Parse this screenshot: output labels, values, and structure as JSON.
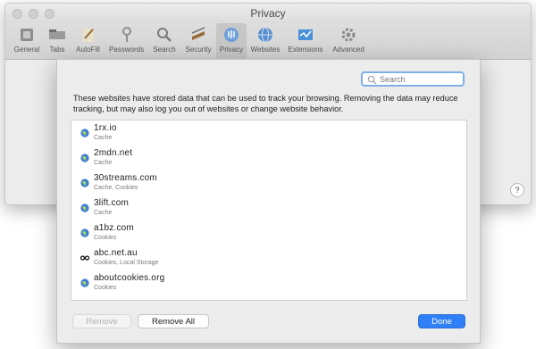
{
  "window": {
    "title": "Privacy"
  },
  "toolbar": {
    "items": [
      {
        "label": "General",
        "icon": "general-icon"
      },
      {
        "label": "Tabs",
        "icon": "tabs-icon"
      },
      {
        "label": "AutoFill",
        "icon": "autofill-icon"
      },
      {
        "label": "Passwords",
        "icon": "passwords-icon"
      },
      {
        "label": "Search",
        "icon": "search-icon"
      },
      {
        "label": "Security",
        "icon": "security-icon"
      },
      {
        "label": "Privacy",
        "icon": "privacy-icon"
      },
      {
        "label": "Websites",
        "icon": "websites-icon"
      },
      {
        "label": "Extensions",
        "icon": "extensions-icon"
      },
      {
        "label": "Advanced",
        "icon": "advanced-icon"
      }
    ],
    "active": "Privacy"
  },
  "help": {
    "label": "?"
  },
  "sheet": {
    "search": {
      "placeholder": "Search",
      "value": ""
    },
    "description": "These websites have stored data that can be used to track your browsing. Removing the data may reduce tracking, but may also log you out of websites or change website behavior.",
    "sites": [
      {
        "name": "1rx.io",
        "detail": "Cache",
        "icon": "globe-icon"
      },
      {
        "name": "2mdn.net",
        "detail": "Cache",
        "icon": "globe-icon"
      },
      {
        "name": "30streams.com",
        "detail": "Cache, Cookies",
        "icon": "globe-icon"
      },
      {
        "name": "3lift.com",
        "detail": "Cache",
        "icon": "globe-icon"
      },
      {
        "name": "a1bz.com",
        "detail": "Cookies",
        "icon": "globe-icon"
      },
      {
        "name": "abc.net.au",
        "detail": "Cookies, Local Storage",
        "icon": "abc-logo-icon"
      },
      {
        "name": "aboutcookies.org",
        "detail": "Cookies",
        "icon": "globe-icon"
      }
    ],
    "buttons": {
      "remove": "Remove",
      "remove_all": "Remove All",
      "done": "Done"
    }
  },
  "colors": {
    "accent": "#2f7ff6",
    "search_focus": "#7faee8"
  }
}
